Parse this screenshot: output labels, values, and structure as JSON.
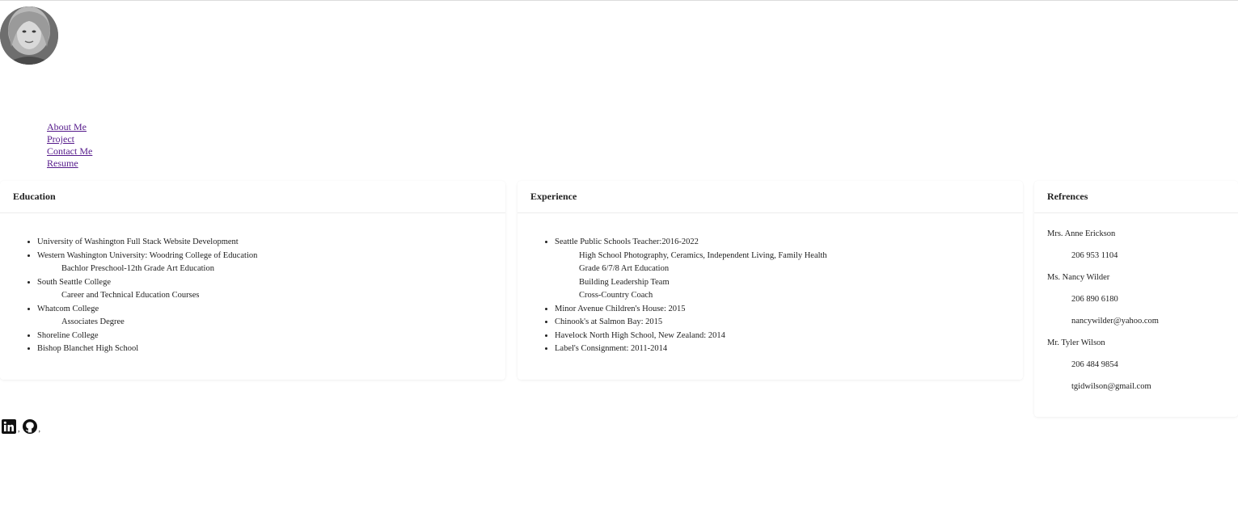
{
  "nav": {
    "items": [
      "About Me",
      "Project",
      "Contact Me",
      "Resume"
    ]
  },
  "education": {
    "title": "Education",
    "items": [
      "University of Washington Full Stack Website Development",
      "Western Washington University: Woodring College of Education",
      "Bachlor Preschool-12th Grade Art Education",
      "South Seattle College",
      "Career and Technical Education Courses",
      "Whatcom College",
      "Associates Degree",
      "Shoreline College",
      "Bishop Blanchet High School"
    ]
  },
  "experience": {
    "title": "Experience",
    "items": [
      "Seattle Public Schools Teacher:2016-2022",
      "High School Photography, Ceramics, Independent Living, Family Health",
      "Grade 6/7/8 Art Education",
      "Building Leadership Team",
      "Cross-Country Coach",
      "Minor Avenue Children's House: 2015",
      "Chinook's at Salmon Bay: 2015",
      "Havelock North High School, New Zealand: 2014",
      "Label's Consignment: 2011-2014"
    ]
  },
  "references": {
    "title": "Refrences",
    "people": [
      {
        "name": "Mrs. Anne Erickson",
        "phone": "206 953 1104"
      },
      {
        "name": "Ms. Nancy Wilder",
        "phone": "206 890 6180",
        "email": "nancywilder@yahoo.com"
      },
      {
        "name": "Mr. Tyler Wilson",
        "phone": "206 484 9854",
        "email": "tgidwilson@gmail.com"
      }
    ]
  },
  "social": {
    "separator": ",",
    "icons": [
      "linkedin-icon",
      "github-icon"
    ]
  },
  "colors": {
    "link": "#551a8b",
    "text": "#222222",
    "divider": "#ececec"
  }
}
